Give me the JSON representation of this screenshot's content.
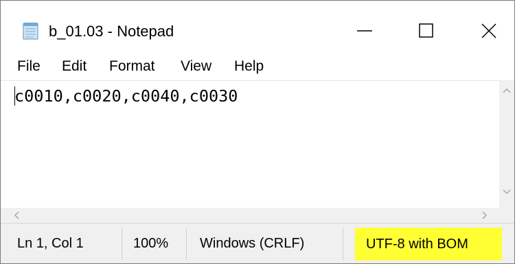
{
  "window": {
    "title": "b_01.03 - Notepad",
    "icon": "notepad-icon"
  },
  "caption_buttons": {
    "minimize_icon": "minimize-icon",
    "maximize_icon": "maximize-icon",
    "close_icon": "close-icon"
  },
  "menu": {
    "items": [
      "File",
      "Edit",
      "Format",
      "View",
      "Help"
    ]
  },
  "editor": {
    "content": "c0010,c0020,c0040,c0030"
  },
  "status_bar": {
    "position": "Ln 1, Col 1",
    "zoom": "100%",
    "line_ending": "Windows (CRLF)",
    "encoding": "UTF-8 with BOM",
    "encoding_highlight_color": "#ffff33"
  }
}
